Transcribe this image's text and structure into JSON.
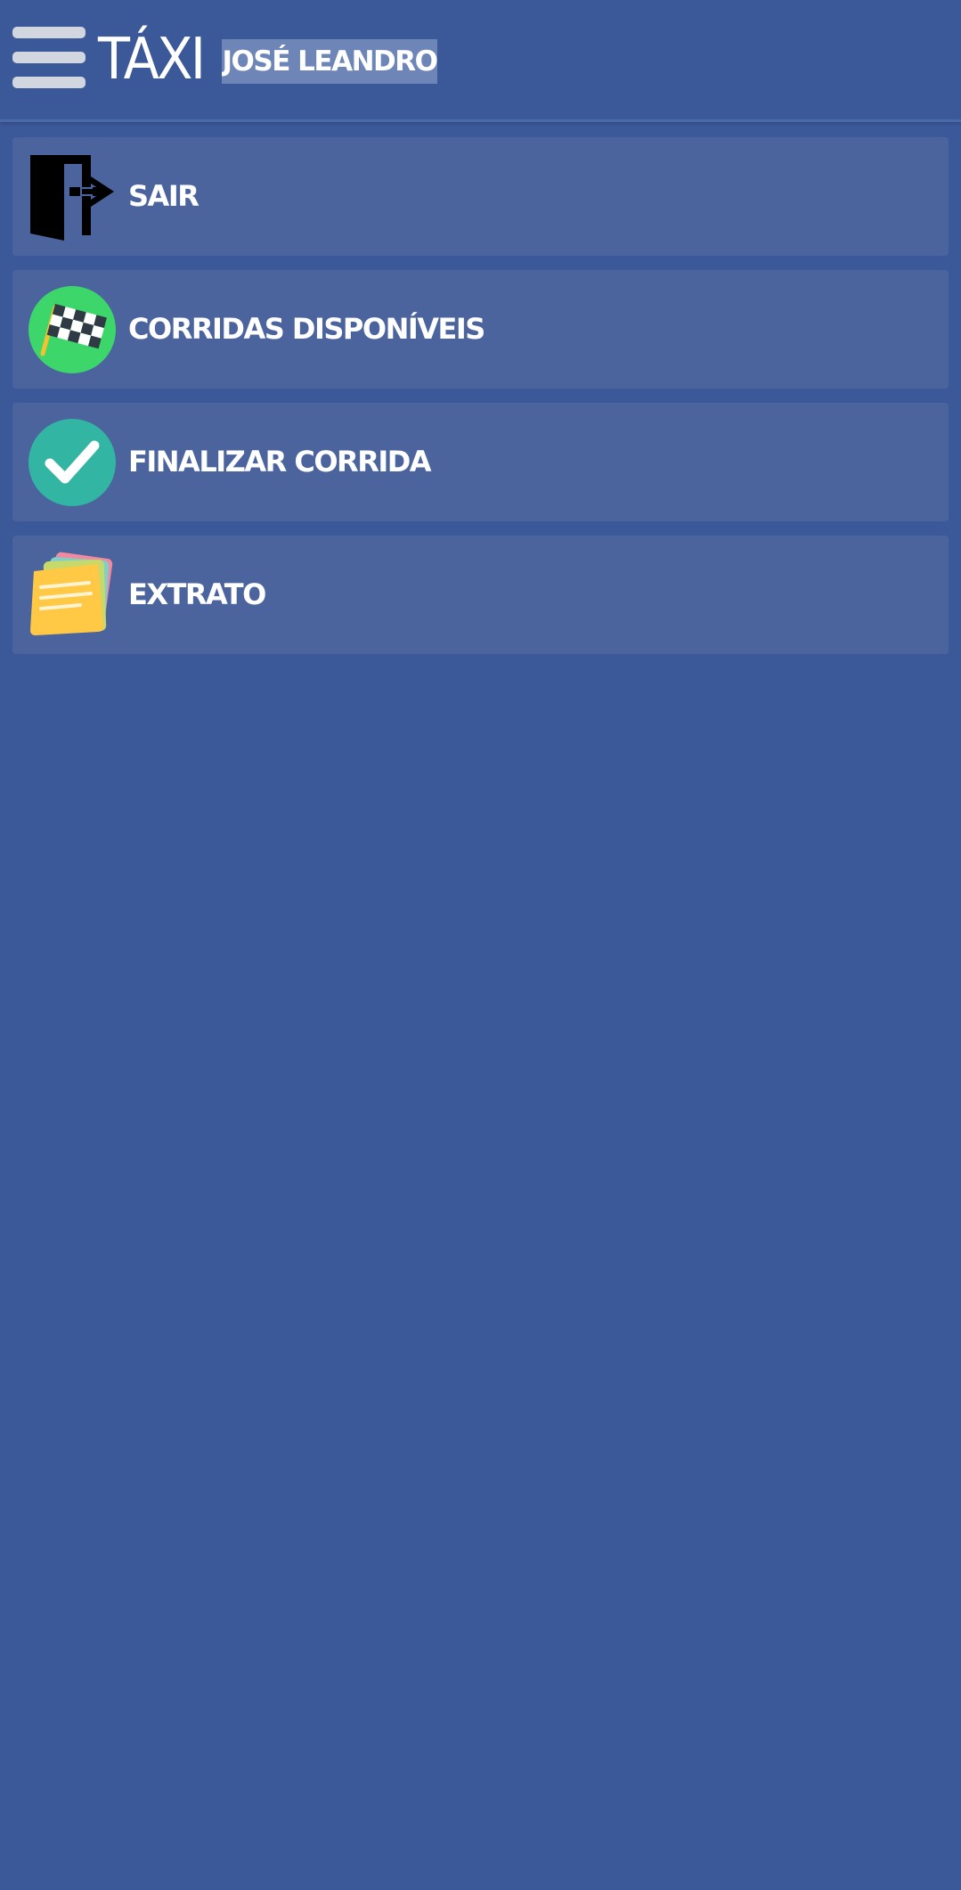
{
  "header": {
    "title": "TÁXI",
    "user_name": "JOSÉ LEANDRO",
    "menu_icon": "hamburger-menu-icon"
  },
  "menu": {
    "items": [
      {
        "label": "SAIR",
        "icon": "exit-door-icon"
      },
      {
        "label": "CORRIDAS DISPONÍVEIS",
        "icon": "checkered-flag-icon"
      },
      {
        "label": "FINALIZAR CORRIDA",
        "icon": "checkmark-icon"
      },
      {
        "label": "EXTRATO",
        "icon": "sticky-notes-icon"
      }
    ]
  },
  "colors": {
    "background": "#3b5899",
    "item_background": "#4b649d",
    "badge_background": "#6e86b7",
    "flag_green": "#3dd66a",
    "check_teal": "#33b5a3",
    "note_yellow": "#ffc845"
  }
}
